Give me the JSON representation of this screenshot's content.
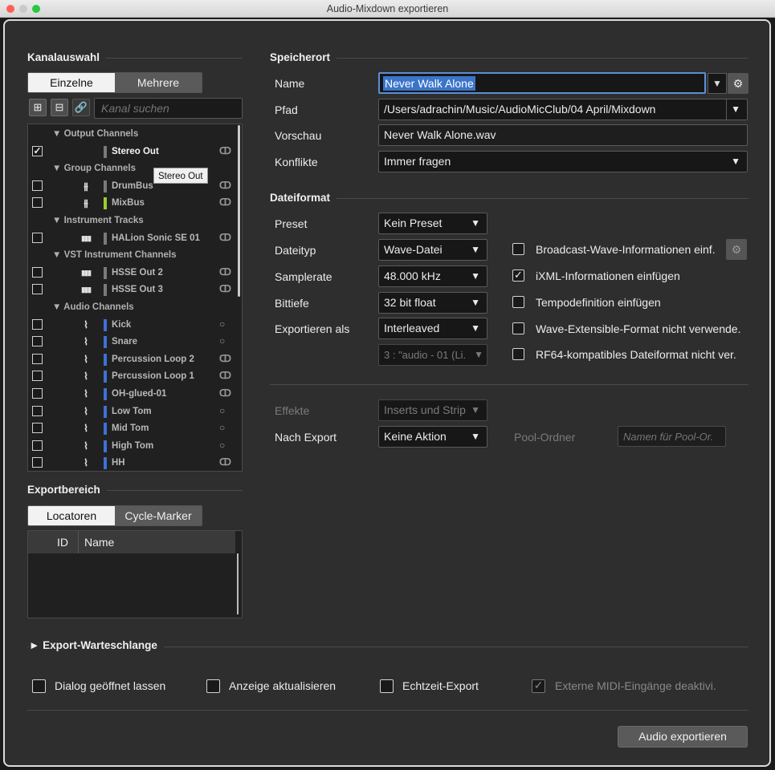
{
  "window": {
    "title": "Audio-Mixdown exportieren"
  },
  "colors": {
    "background": "#2e2e2e",
    "field": "#171717",
    "name_highlight": "#3b74c9",
    "accent_green": "#9acd32",
    "accent_blue": "#3f6fd8"
  },
  "left": {
    "kanalauswahl": {
      "title": "Kanalauswahl",
      "mode_tabs": [
        "Einzelne",
        "Mehrere"
      ],
      "search_placeholder": "Kanal suchen",
      "tree": [
        {
          "type": "group",
          "label": "▼ Output Channels"
        },
        {
          "type": "item",
          "checked": true,
          "name": "Stereo Out",
          "icon": "",
          "color": "#7a7a7a",
          "channel": "stereo",
          "white": true
        },
        {
          "type": "group",
          "label": "▼ Group Channels"
        },
        {
          "type": "item",
          "checked": false,
          "name": "DrumBus",
          "icon": "group-icon",
          "color": "#7a7a7a",
          "channel": "stereo"
        },
        {
          "type": "item",
          "checked": false,
          "name": "MixBus",
          "icon": "group-icon",
          "color": "#9acd32",
          "channel": "stereo"
        },
        {
          "type": "group",
          "label": "▼ Instrument Tracks"
        },
        {
          "type": "item",
          "checked": false,
          "name": "HALion Sonic SE 01",
          "icon": "keyboard-icon",
          "color": "#7a7a7a",
          "channel": "stereo"
        },
        {
          "type": "group",
          "label": "▼ VST Instrument Channels"
        },
        {
          "type": "item",
          "checked": false,
          "name": "HSSE Out 2",
          "icon": "keyboard-icon",
          "color": "#7a7a7a",
          "channel": "stereo"
        },
        {
          "type": "item",
          "checked": false,
          "name": "HSSE Out 3",
          "icon": "keyboard-icon",
          "color": "#7a7a7a",
          "channel": "stereo"
        },
        {
          "type": "group",
          "label": "▼ Audio Channels"
        },
        {
          "type": "item",
          "checked": false,
          "name": "Kick",
          "icon": "waveform-icon",
          "color": "#3f6fd8",
          "channel": "mono"
        },
        {
          "type": "item",
          "checked": false,
          "name": "Snare",
          "icon": "waveform-icon",
          "color": "#3f6fd8",
          "channel": "mono"
        },
        {
          "type": "item",
          "checked": false,
          "name": "Percussion Loop 2",
          "icon": "waveform-icon",
          "color": "#3f6fd8",
          "channel": "stereo"
        },
        {
          "type": "item",
          "checked": false,
          "name": "Percussion Loop 1",
          "icon": "waveform-icon",
          "color": "#3f6fd8",
          "channel": "stereo"
        },
        {
          "type": "item",
          "checked": false,
          "name": "OH-glued-01",
          "icon": "waveform-icon",
          "color": "#3f6fd8",
          "channel": "stereo"
        },
        {
          "type": "item",
          "checked": false,
          "name": "Low Tom",
          "icon": "waveform-icon",
          "color": "#3f6fd8",
          "channel": "mono"
        },
        {
          "type": "item",
          "checked": false,
          "name": "Mid Tom",
          "icon": "waveform-icon",
          "color": "#3f6fd8",
          "channel": "mono"
        },
        {
          "type": "item",
          "checked": false,
          "name": "High Tom",
          "icon": "waveform-icon",
          "color": "#3f6fd8",
          "channel": "mono"
        },
        {
          "type": "item",
          "checked": false,
          "name": "HH",
          "icon": "waveform-icon",
          "color": "#3f6fd8",
          "channel": "stereo"
        }
      ],
      "tooltip": "Stereo Out"
    },
    "exportbereich": {
      "title": "Exportbereich",
      "tabs": [
        "Locatoren",
        "Cycle-Marker"
      ],
      "columns": [
        "ID",
        "Name"
      ]
    }
  },
  "right": {
    "speicherort": {
      "title": "Speicherort",
      "name_label": "Name",
      "name_value": "Never Walk Alone",
      "pfad_label": "Pfad",
      "pfad_value": "/Users/adrachin/Music/AudioMicClub/04 April/Mixdown",
      "vorschau_label": "Vorschau",
      "vorschau_value": "Never Walk Alone.wav",
      "konflikte_label": "Konflikte",
      "konflikte_value": "Immer fragen"
    },
    "dateiformat": {
      "title": "Dateiformat",
      "preset_label": "Preset",
      "preset_value": "Kein Preset",
      "dateityp_label": "Dateityp",
      "dateityp_value": "Wave-Datei",
      "samplerate_label": "Samplerate",
      "samplerate_value": "48.000 kHz",
      "bittiefe_label": "Bittiefe",
      "bittiefe_value": "32 bit float",
      "exportieren_label": "Exportieren als",
      "exportieren_value": "Interleaved",
      "channel_value": "3 : \"audio - 01 (Li.",
      "options": [
        {
          "label": "Broadcast-Wave-Informationen einf.",
          "checked": false
        },
        {
          "label": "iXML-Informationen einfügen",
          "checked": true
        },
        {
          "label": "Tempodefinition einfügen",
          "checked": false
        },
        {
          "label": "Wave-Extensible-Format nicht verwende.",
          "checked": false
        },
        {
          "label": "RF64-kompatibles Dateiformat nicht ver.",
          "checked": false
        }
      ],
      "effekte_label": "Effekte",
      "effekte_value": "Inserts und Strip",
      "nachexport_label": "Nach Export",
      "nachexport_value": "Keine Aktion",
      "pool_label": "Pool-Ordner",
      "pool_placeholder": "Namen für Pool-Or."
    }
  },
  "queue": {
    "title": "► Export-Warteschlange"
  },
  "bottom": {
    "options": [
      {
        "label": "Dialog geöffnet lassen",
        "checked": false
      },
      {
        "label": "Anzeige aktualisieren",
        "checked": false
      },
      {
        "label": "Echtzeit-Export",
        "checked": false
      },
      {
        "label": "Externe MIDI-Eingänge deaktivi.",
        "checked": true,
        "disabled": true
      }
    ],
    "export_button": "Audio exportieren"
  }
}
